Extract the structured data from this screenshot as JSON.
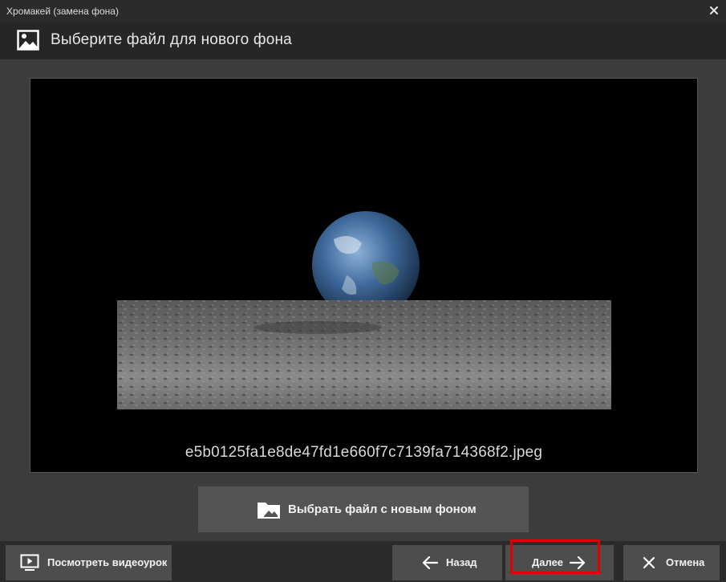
{
  "window": {
    "title": "Хромакей (замена фона)"
  },
  "header": {
    "title": "Выберите файл для нового фона"
  },
  "preview": {
    "filename": "e5b0125fa1e8de47fd1e660f7c7139fa714368f2.jpeg"
  },
  "actions": {
    "choose_file_label": "Выбрать файл с новым фоном"
  },
  "footer": {
    "video_label": "Посмотреть видеоурок",
    "back_label": "Назад",
    "next_label": "Далее",
    "cancel_label": "Отмена"
  },
  "colors": {
    "highlight": "#e00000",
    "button_bg": "#4d4d4d",
    "window_bg": "#3c3c3c"
  },
  "icons": {
    "window_close": "close-icon",
    "header": "image-icon",
    "choose_file": "folder-image-icon",
    "video": "play-screen-icon",
    "back": "arrow-left-icon",
    "next": "arrow-right-icon",
    "cancel": "close-icon"
  }
}
